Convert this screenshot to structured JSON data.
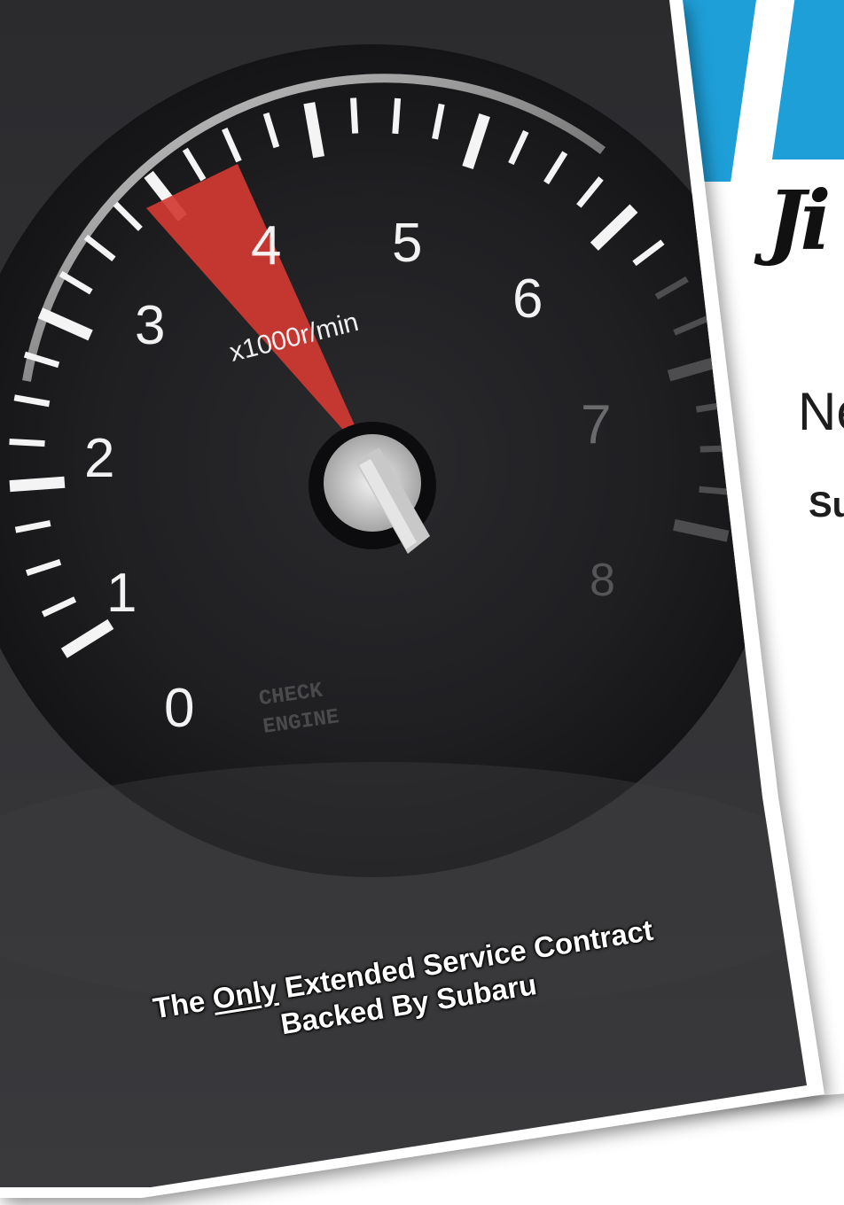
{
  "tachometer": {
    "numbers": [
      "0",
      "1",
      "2",
      "3",
      "4",
      "5",
      "6",
      "7",
      "8"
    ],
    "unit_label": "x1000r/min",
    "warning_label_line1": "CHECK",
    "warning_label_line2": "ENGINE",
    "needle_rpm_x1000": 3.8
  },
  "tagline": {
    "prefix": "The ",
    "emphasis": "Only",
    "line1_rest": " Extended Service Contract",
    "line2": "Backed By Subaru"
  },
  "back_panel": {
    "text_1": "Ne",
    "text_2": "Su"
  },
  "colors": {
    "stripe": "#1e9fd8",
    "needle_sweep": "#d23a32",
    "dial": "#1d1d1f"
  }
}
